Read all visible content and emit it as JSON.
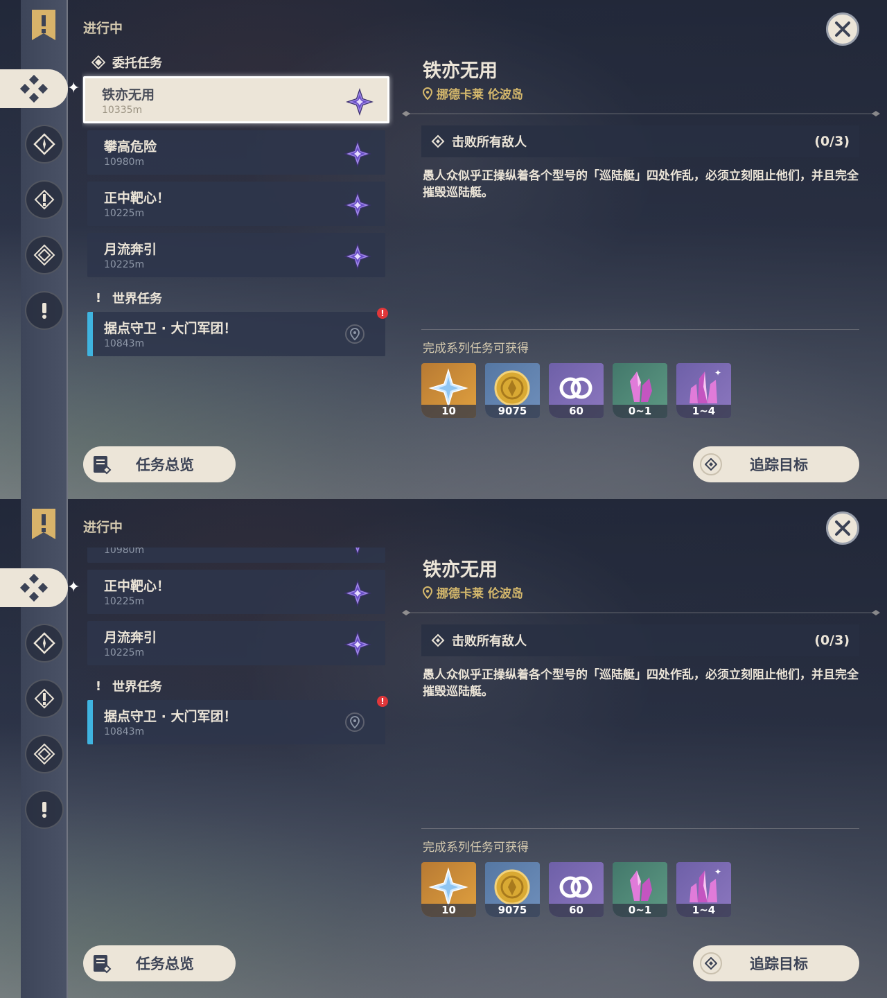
{
  "header": {
    "status_label": "进行中"
  },
  "sections": {
    "commission": {
      "label": "委托任务"
    },
    "world": {
      "label": "世界任务"
    }
  },
  "quests": [
    {
      "name": "铁亦无用",
      "distance": "10335m"
    },
    {
      "name": "攀高危险",
      "distance": "10980m"
    },
    {
      "name": "正中靶心！",
      "distance": "10225m"
    },
    {
      "name": "月流奔引",
      "distance": "10225m"
    }
  ],
  "world_quest": {
    "name": "据点守卫 · 大门军团！",
    "distance": "10843m",
    "alert": "!"
  },
  "detail": {
    "title": "铁亦无用",
    "location": "挪德卡莱 伦波岛",
    "objective": "击败所有敌人",
    "objective_count": "(0/3)",
    "description": "愚人众似乎正操纵着各个型号的「巡陆艇」四处作乱，必须立刻阻止他们，并且完全摧毁巡陆艇。",
    "rewards_label": "完成系列任务可获得",
    "rewards": [
      {
        "icon": "primogem-icon",
        "count": "10"
      },
      {
        "icon": "mora-icon",
        "count": "9075"
      },
      {
        "icon": "companionship-icon",
        "count": "60"
      },
      {
        "icon": "crystal-chunk-icon",
        "count": "0~1"
      },
      {
        "icon": "crystal-cluster-icon",
        "count": "1~4"
      }
    ]
  },
  "buttons": {
    "overview": "任务总览",
    "track": "追踪目标"
  },
  "colors": {
    "panel": "#ece5d8",
    "world_accent": "#3fb4e0",
    "location": "#d6b96c",
    "alert": "#e0373a"
  }
}
